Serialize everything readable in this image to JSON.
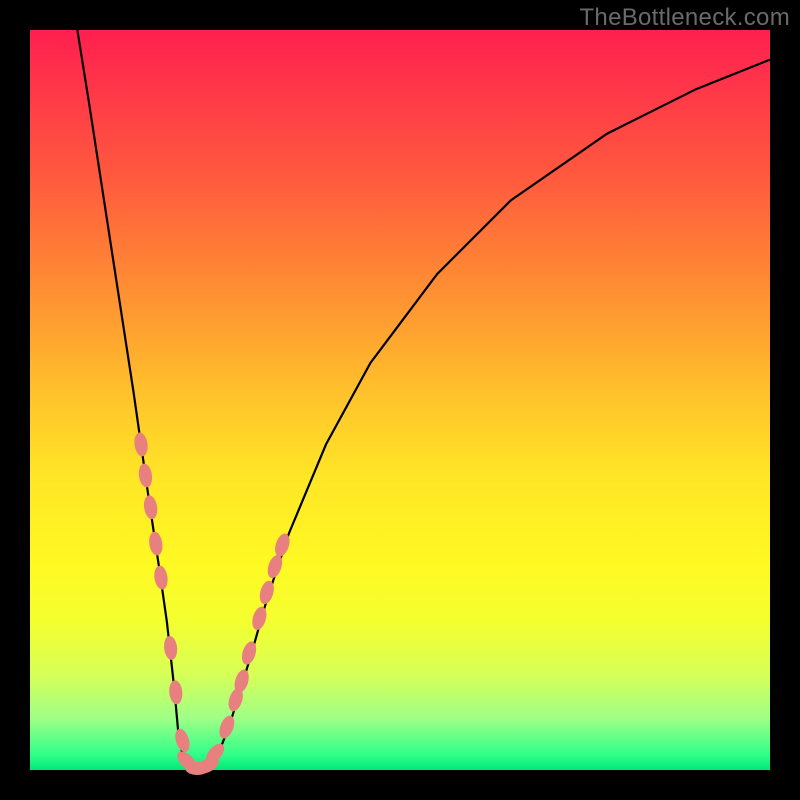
{
  "watermark": "TheBottleneck.com",
  "colors": {
    "page_bg": "#000000",
    "watermark_text": "#6a6a6a",
    "curve": "#000000",
    "marker": "#e8807f",
    "gradient_top": "#ff1f4f",
    "gradient_bottom": "#00e87a"
  },
  "chart_data": {
    "type": "line",
    "title": "",
    "xlabel": "",
    "ylabel": "",
    "xlim": [
      0,
      100
    ],
    "ylim": [
      0,
      100
    ],
    "notes": "Curve shows bottleneck percentage (y, 0=ideal green) across a balance parameter (x). Values are estimated from pixel positions since axes are unlabeled.",
    "series": [
      {
        "name": "bottleneck-curve",
        "x": [
          6.4,
          8,
          10,
          12,
          14,
          16,
          17.5,
          18.5,
          19.5,
          20,
          20.5,
          21,
          22,
          23,
          24,
          25,
          26,
          27,
          28.5,
          30,
          32,
          35,
          40,
          46,
          55,
          65,
          78,
          90,
          100
        ],
        "y": [
          100,
          90,
          77,
          64,
          51,
          37,
          27,
          20,
          11,
          5.5,
          2.6,
          1,
          0,
          0,
          0.5,
          1.7,
          3.6,
          6.2,
          11,
          16,
          23,
          32,
          44,
          55,
          67,
          77,
          86,
          92,
          96
        ]
      }
    ],
    "markers": {
      "name": "highlighted-points",
      "note": "Salmon lozenge markers along lower part of curve; x,y in same 0-100 space",
      "points": [
        {
          "x": 15.0,
          "y": 44.0
        },
        {
          "x": 15.6,
          "y": 39.8
        },
        {
          "x": 16.3,
          "y": 35.5
        },
        {
          "x": 17.0,
          "y": 30.6
        },
        {
          "x": 17.7,
          "y": 26.0
        },
        {
          "x": 19.0,
          "y": 16.5
        },
        {
          "x": 19.7,
          "y": 10.5
        },
        {
          "x": 20.6,
          "y": 4.0
        },
        {
          "x": 21.2,
          "y": 1.2
        },
        {
          "x": 22.6,
          "y": 0.2
        },
        {
          "x": 24.0,
          "y": 0.6
        },
        {
          "x": 25.0,
          "y": 2.2
        },
        {
          "x": 26.6,
          "y": 5.8
        },
        {
          "x": 27.8,
          "y": 9.5
        },
        {
          "x": 28.6,
          "y": 12.0
        },
        {
          "x": 29.6,
          "y": 15.8
        },
        {
          "x": 31.0,
          "y": 20.5
        },
        {
          "x": 32.0,
          "y": 24.0
        },
        {
          "x": 33.1,
          "y": 27.5
        },
        {
          "x": 34.1,
          "y": 30.4
        }
      ]
    }
  }
}
